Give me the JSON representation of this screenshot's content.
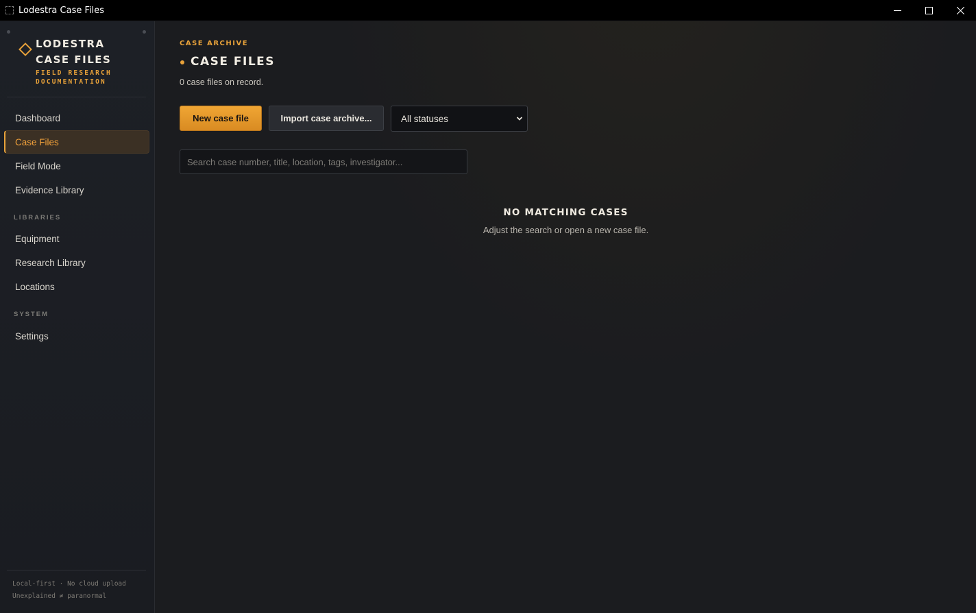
{
  "window": {
    "title": "Lodestra Case Files"
  },
  "sidebar": {
    "brand_line1": "LODESTRA",
    "brand_line2": "CASE FILES",
    "brand_sub1": "FIELD RESEARCH",
    "brand_sub2": "DOCUMENTATION",
    "nav": [
      {
        "label": "Dashboard",
        "active": false
      },
      {
        "label": "Case Files",
        "active": true
      },
      {
        "label": "Field Mode",
        "active": false
      },
      {
        "label": "Evidence Library",
        "active": false
      }
    ],
    "libraries_label": "LIBRARIES",
    "libraries": [
      {
        "label": "Equipment"
      },
      {
        "label": "Research Library"
      },
      {
        "label": "Locations"
      }
    ],
    "system_label": "SYSTEM",
    "system": [
      {
        "label": "Settings"
      }
    ],
    "footer_line1": "Local-first · No cloud upload",
    "footer_line2": "Unexplained ≠ paranormal"
  },
  "main": {
    "eyebrow": "CASE ARCHIVE",
    "title": "CASE FILES",
    "count_text": "0 case files on record.",
    "new_button": "New case file",
    "import_button": "Import case archive...",
    "status_filter": "All statuses",
    "search_placeholder": "Search case number, title, location, tags, investigator...",
    "empty_title": "NO MATCHING CASES",
    "empty_sub": "Adjust the search or open a new case file."
  },
  "colors": {
    "accent": "#e8a23a",
    "background": "#1b1c1f",
    "sidebar": "#1d2026"
  }
}
